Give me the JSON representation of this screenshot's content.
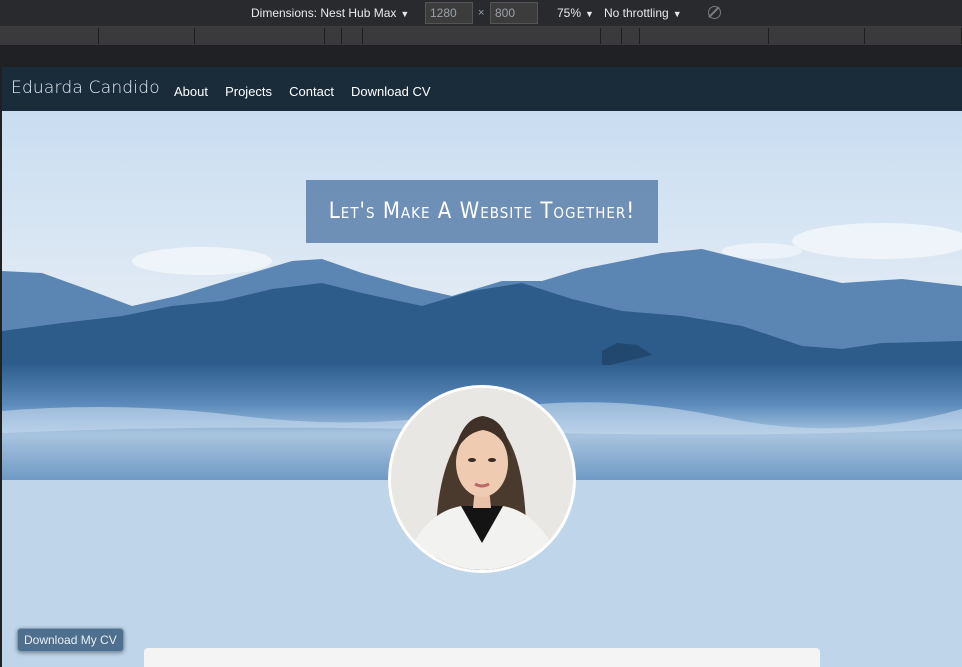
{
  "devtools": {
    "dimensions_label": "Dimensions: Nest Hub Max",
    "width_value": "1280",
    "height_value": "800",
    "zoom_label": "75%",
    "throttling_label": "No throttling",
    "icons": {
      "rotate": "rotate-icon",
      "caret": "caret-down-icon"
    }
  },
  "site": {
    "brand": "Eduarda Candido",
    "nav": [
      "About",
      "Projects",
      "Contact",
      "Download CV"
    ],
    "hero_title": "Let's Make A Website Together!",
    "download_button": "Download My CV"
  },
  "colors": {
    "nav_bg": "#1a2b3a",
    "page_bg": "#bfd6ea",
    "hero_box": "#5c80aa",
    "button_bg": "#4f6f8f"
  }
}
